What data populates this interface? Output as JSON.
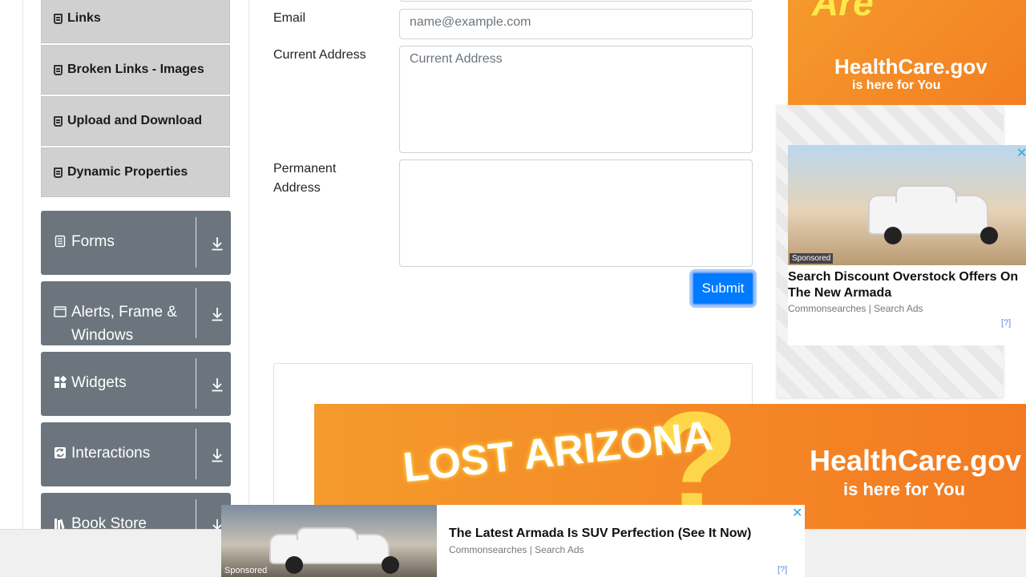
{
  "sidebar": {
    "sub_items": [
      {
        "label": "Links",
        "icon": "form-icon"
      },
      {
        "label": "Broken Links - Images",
        "icon": "form-icon"
      },
      {
        "label": "Upload and Download",
        "icon": "form-icon"
      },
      {
        "label": "Dynamic Properties",
        "icon": "form-icon"
      }
    ],
    "groups": [
      {
        "label": "Forms",
        "icon": "document-icon"
      },
      {
        "label": "Alerts, Frame & Windows",
        "icon": "window-icon"
      },
      {
        "label": "Widgets",
        "icon": "widgets-icon"
      },
      {
        "label": "Interactions",
        "icon": "interactions-icon"
      },
      {
        "label": "Book Store Application",
        "icon": "books-icon"
      }
    ]
  },
  "form": {
    "email_label": "Email",
    "email_placeholder": "name@example.com",
    "current_address_label": "Current Address",
    "current_address_placeholder": "Current Address",
    "permanent_address_label": "Permanent Address",
    "submit_label": "Submit"
  },
  "ads": {
    "top_ad": {
      "brand": "HealthCare.gov",
      "tagline": "is here for You",
      "headline_fragment": "Are"
    },
    "mid_ad": {
      "sponsored": "Sponsored",
      "headline": "Search Discount Overstock Offers On The New Armada",
      "source": "Commonsearches | Search Ads",
      "adchoice": "[?]"
    },
    "banner": {
      "headline": "LOST ARIZONA",
      "brand": "HealthCare.gov",
      "tagline": "is here for You"
    },
    "bottom_ad": {
      "sponsored": "Sponsored",
      "headline": "The Latest Armada Is SUV Perfection (See It Now)",
      "source": "Commonsearches | Search Ads",
      "adchoice": "[?]"
    },
    "close_glyph": "✕",
    "colors": {
      "accent": "#007bff",
      "ad_orange": "#f59a2c",
      "ad_yellow": "#fde94a",
      "sidebar_group": "#6c757d"
    }
  }
}
